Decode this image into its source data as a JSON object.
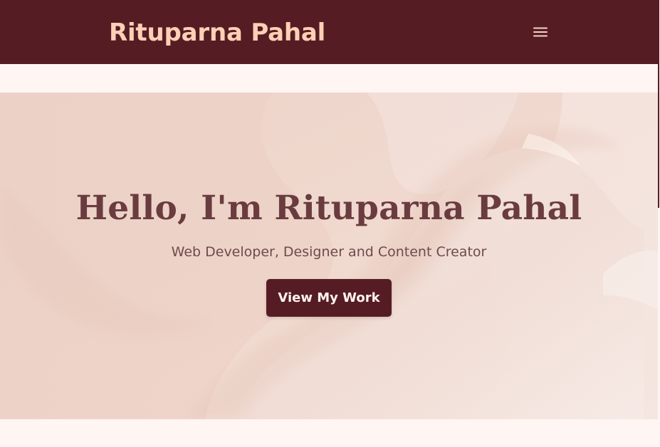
{
  "brand": {
    "name": "Rituparna Pahal"
  },
  "navbar": {
    "menu_icon": "hamburger-menu-icon"
  },
  "hero": {
    "title": "Hello, I'm Rituparna Pahal",
    "subtitle": "Web Developer, Designer and Content Creator",
    "cta_label": "View My Work"
  },
  "colors": {
    "header": "#561c24",
    "brand": "#ffd0b5",
    "page_background": "#fff5f3",
    "hero_background": "#efd9ce",
    "hero_title": "#6a3c3f",
    "hero_subtitle": "#6d4b4b",
    "button_text": "#fff5f1"
  }
}
